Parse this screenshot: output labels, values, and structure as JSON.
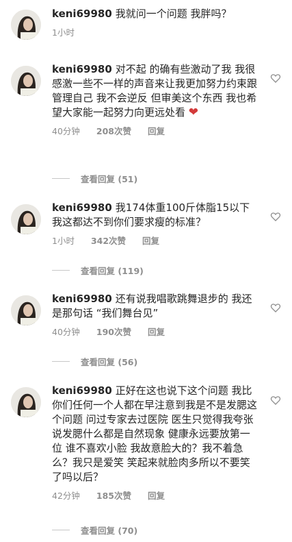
{
  "comments": [
    {
      "user": "keni69980",
      "text": "我就问一个问题 我胖吗？",
      "time": "1小时",
      "likes": "",
      "reply": "",
      "replies": ""
    },
    {
      "user": "keni69980",
      "text": "对不起 的确有些激动了我 我很感激一些不一样的声音来让我更加努力约束跟管理自己 我不会逆反 但审美这个东西 我也希望大家能一起努力向更远处看",
      "heart": "❤",
      "time": "40分钟",
      "likes": "208次赞",
      "reply": "回复",
      "replies": "查看回复 (51)"
    },
    {
      "user": "keni69980",
      "text": "我174体重100斤体脂15以下我这都达不到你们要求瘦的标准？",
      "time": "1小时",
      "likes": "342次赞",
      "reply": "回复",
      "replies": "查看回复 (119)"
    },
    {
      "user": "keni69980",
      "text": "还有说我唱歌跳舞退步的 我还是那句话 “我们舞台见”",
      "time": "40分钟",
      "likes": "190次赞",
      "reply": "回复",
      "replies": "查看回复 (56)"
    },
    {
      "user": "keni69980",
      "text": "正好在这也说下这个问题 我比你们任何一个人都在早注意到我是不是发腮这个问题 问过专家去过医院 医生只觉得我夸张 说发腮什么都是自然现象 健康永远要放第一位 谁不喜欢小脸 我故意脸大的？我不着急么？我只是爱笑 笑起来就脸肉多所以不要笑了吗以后？",
      "time": "42分钟",
      "likes": "185次赞",
      "reply": "回复",
      "replies": "查看回复 (70)"
    }
  ],
  "colors": {
    "text": "#262626",
    "meta": "#8e8e8e",
    "heart": "#d33a3a"
  }
}
